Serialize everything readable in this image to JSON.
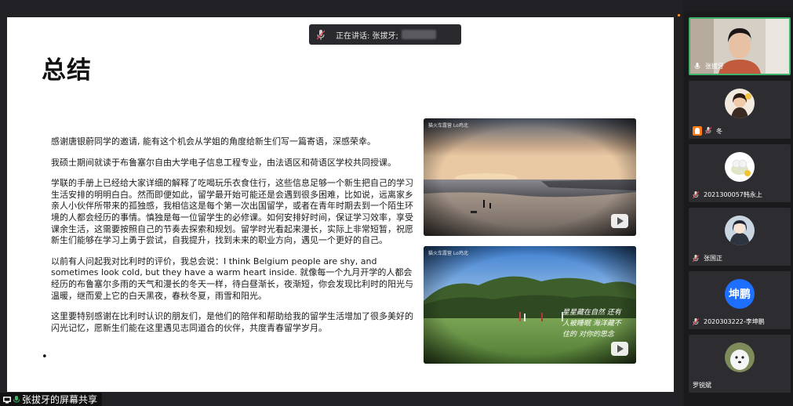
{
  "speaking": {
    "label": "正在讲话: 张拔牙;"
  },
  "slide": {
    "title": "总结",
    "paragraphs": [
      "感谢唐银蔚同学的邀请, 能有这个机会从学姐的角度给新生们写一篇寄语，深感荣幸。",
      "我硕士期间就读于布鲁塞尔自由大学电子信息工程专业，由法语区和荷语区学校共同授课。",
      "学联的手册上已经给大家详细的解释了吃喝玩乐衣食住行，这些信息足够一个新生把自己的学习生活安排的明明白白。然而即便如此，留学最开始可能还是会遇到很多困难，比如说，远离家乡亲人小伙伴所带来的孤独感，我相信这是每个第一次出国留学，或者在青年时期去到一个陌生环境的人都会经历的事情。慎独是每一位留学生的必修课。如何安排好时间，保证学习效率，享受课余生活，这需要按照自己的节奏去探索和规划。留学时光看起来漫长，实际上非常短暂，祝愿新生们能够在学习上勇于尝试，自我提升，找到未来的职业方向，遇见一个更好的自己。",
      "以前有人问起我对比利时的评价，我总会说：I think Belgium people are shy, and sometimes look cold, but they have a warm heart inside. 就像每一个九月开学的人都会经历的布鲁塞尔多雨的天气和漫长的冬天一样，待白昼渐长，夜渐短，你会发现比利时的阳光与温暖，继而爱上它的白天黑夜，春秋冬夏，雨雪和阳光。",
      "这里要特别感谢在比利时认识的朋友们，是他们的陪伴和帮助给我的留学生活增加了很多美好的闪光记忆，愿新生们能在这里遇见志同道合的伙伴，共度青春留学岁月。"
    ],
    "photo1_watermark": "猫火车露营 Lo鸡北",
    "photo2_watermark": "猫火车露营 Lo鸡北",
    "photo2_handwriting": "星星藏在自然 还有人被睡眠 海洋藏不住的 对你的思念"
  },
  "share_label": "张拔牙的屏幕共享",
  "participants": [
    {
      "name": "张拔牙",
      "type": "video"
    },
    {
      "name": "冬",
      "type": "avatar-photo"
    },
    {
      "name": "2021300057韩永上",
      "type": "avatar-photo"
    },
    {
      "name": "张国正",
      "type": "avatar-photo"
    },
    {
      "name": "2020303222-李坤鹏",
      "type": "avatar-text",
      "avatar_text": "坤鹏"
    },
    {
      "name": "罗锐斌",
      "type": "avatar-photo"
    }
  ],
  "colors": {
    "accent_green": "#3fb36b",
    "avatar_blue": "#1e6fff",
    "badge_orange": "#ff7d18",
    "mic_muted_red": "#e04848"
  },
  "icons": [
    "mic-muted-icon",
    "mic-icon",
    "screen-share-icon",
    "play-icon",
    "host-badge-icon"
  ]
}
